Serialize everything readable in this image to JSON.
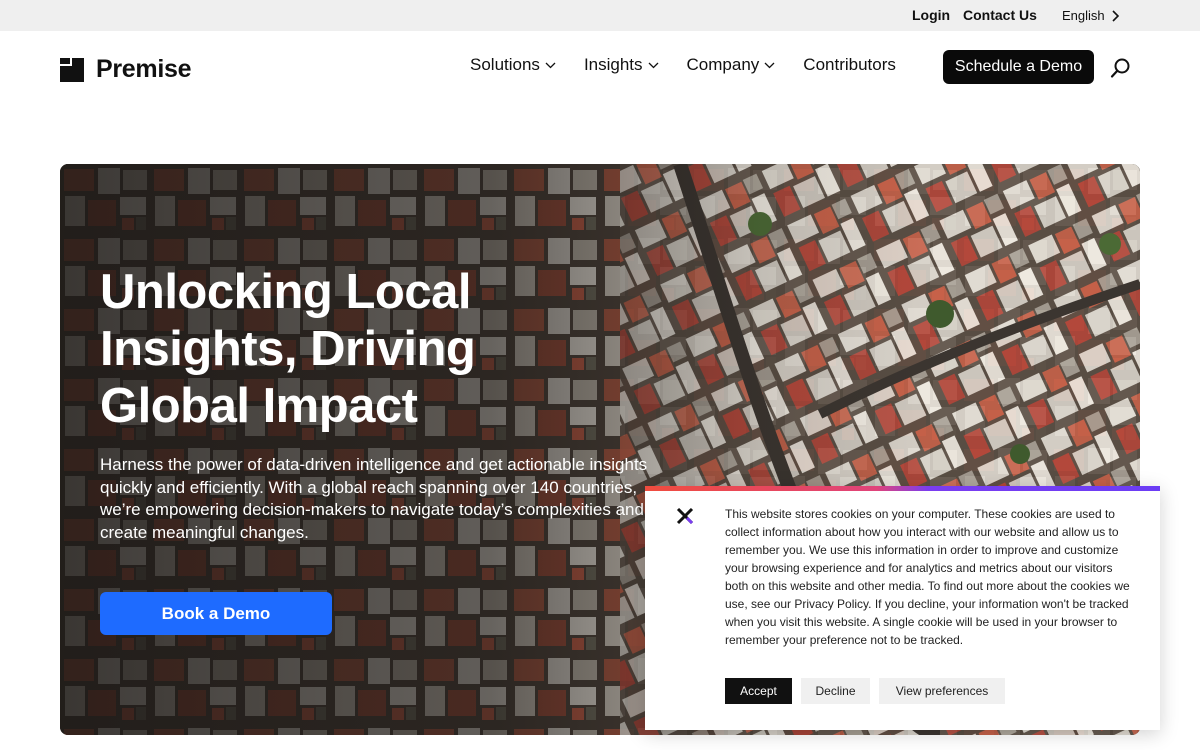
{
  "utility_bar": {
    "login": "Login",
    "contact": "Contact Us",
    "language": "English"
  },
  "header": {
    "logo_text": "Premise",
    "nav": [
      {
        "label": "Solutions",
        "has_dropdown": true
      },
      {
        "label": "Insights",
        "has_dropdown": true
      },
      {
        "label": "Company",
        "has_dropdown": true
      },
      {
        "label": "Contributors",
        "has_dropdown": false
      }
    ],
    "cta": "Schedule a Demo",
    "search_icon": "search-icon"
  },
  "hero": {
    "title": "Unlocking Local Insights, Driving Global Impact",
    "subtitle": "Harness the power of data-driven intelligence and get actionable insights quickly and efficiently. With a global reach spanning over 140 countries, we’re empowering decision-makers to navigate today’s complexities and create meaningful changes.",
    "button": "Book a Demo",
    "button_color": "#1e6bff"
  },
  "cookie_banner": {
    "text": "This website stores cookies on your computer. These cookies are used to collect information about how you interact with our website and allow us to remember you. We use this information in order to improve and customize your browsing experience and for analytics and metrics about our visitors both on this website and other media. To find out more about the cookies we use, see our Privacy Policy. If you decline, your information won't be tracked when you visit this website. A single cookie will be used in your browser to remember your preference not to be tracked.",
    "accept": "Accept",
    "decline": "Decline",
    "preferences": "View preferences",
    "close_icon": "close-icon"
  },
  "colors": {
    "accent": "#1e6bff",
    "dark": "#0a0a0a",
    "utility_bg": "#efefef"
  }
}
